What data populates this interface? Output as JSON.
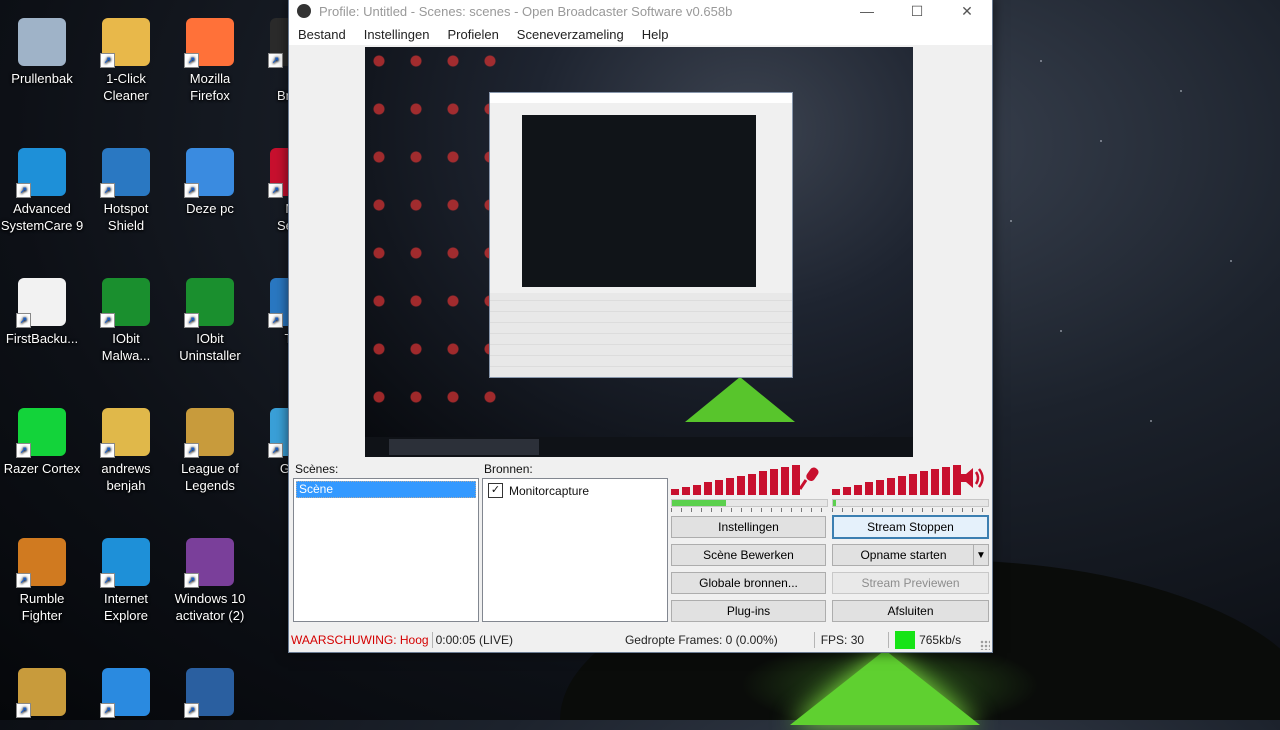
{
  "desktop": {
    "icons": [
      {
        "label": "Prullenbak",
        "icon": "recycle-bin-icon",
        "color": "#9fb3c8"
      },
      {
        "label": "1-Click\nCleaner",
        "icon": "broom-icon",
        "color": "#e8b84a"
      },
      {
        "label": "Mozilla\nFirefox",
        "icon": "firefox-icon",
        "color": "#ff7139"
      },
      {
        "label": "O\nBroac",
        "icon": "obs-icon",
        "color": "#2b2b2b"
      },
      {
        "label": "Advanced\nSystemCare 9",
        "icon": "advanced-systemcare-icon",
        "color": "#1e90d8"
      },
      {
        "label": "Hotspot\nShield",
        "icon": "hotspot-shield-icon",
        "color": "#2a78c2"
      },
      {
        "label": "Deze pc",
        "icon": "computer-icon",
        "color": "#3a8be0"
      },
      {
        "label": "Mc\nSecur",
        "icon": "mcafee-icon",
        "color": "#c8102e"
      },
      {
        "label": "FirstBacku...",
        "icon": "document-icon",
        "color": "#f2f2f2"
      },
      {
        "label": "IObit\nMalwa...",
        "icon": "iobit-malware-icon",
        "color": "#1a8f2e"
      },
      {
        "label": "IObit\nUninstaller",
        "icon": "iobit-uninstaller-icon",
        "color": "#1a8f2e"
      },
      {
        "label": "Tru",
        "icon": "app-icon",
        "color": "#2a78c2"
      },
      {
        "label": "Razer Cortex",
        "icon": "razer-cortex-icon",
        "color": "#13d33a"
      },
      {
        "label": "andrews\nbenjah",
        "icon": "user-folder-icon",
        "color": "#e0b84a"
      },
      {
        "label": "League of\nLegends",
        "icon": "league-of-legends-icon",
        "color": "#c89b3c"
      },
      {
        "label": "Gam",
        "icon": "app-icon",
        "color": "#3aa0d8"
      },
      {
        "label": "Rumble\nFighter",
        "icon": "rumble-fighter-icon",
        "color": "#d07a20"
      },
      {
        "label": "Internet\nExplore",
        "icon": "internet-explorer-icon",
        "color": "#1e90d8"
      },
      {
        "label": "Windows 10\nactivator (2)",
        "icon": "winrar-icon",
        "color": "#7a3f9a"
      },
      {
        "label": "",
        "icon": "league-of-legends-icon",
        "color": "#c89b3c"
      },
      {
        "label": "",
        "icon": "windows10-icon",
        "color": "#2a8ae0"
      },
      {
        "label": "",
        "icon": "battlenet-icon",
        "color": "#2a5fa0"
      }
    ]
  },
  "window": {
    "title": "Profile: Untitled - Scenes: scenes - Open Broadcaster Software v0.658b",
    "controls": {
      "minimize": "—",
      "maximize": "☐",
      "close": "✕"
    },
    "menu": [
      "Bestand",
      "Instellingen",
      "Profielen",
      "Sceneverzameling",
      "Help"
    ]
  },
  "scenes": {
    "label": "Scènes:",
    "items": [
      "Scène"
    ]
  },
  "sources": {
    "label": "Bronnen:",
    "items": [
      {
        "name": "Monitorcapture",
        "checked": true
      }
    ]
  },
  "audio": {
    "mic_icon": "microphone-icon",
    "speaker_icon": "speaker-icon",
    "mic_level": 0.35,
    "desktop_level": 0.02,
    "meter_color": "#c8102e",
    "slider_color": "#5bd04d"
  },
  "buttons": {
    "settings": "Instellingen",
    "stop_stream": "Stream Stoppen",
    "edit_scene": "Scène Bewerken",
    "start_recording": "Opname starten",
    "global_sources": "Globale bronnen...",
    "preview_stream": "Stream Previewen",
    "plugins": "Plug-ins",
    "exit": "Afsluiten"
  },
  "status": {
    "warning": "WAARSCHUWING: Hoog",
    "time": "0:00:05 (LIVE)",
    "dropped": "Gedropte Frames: 0 (0.00%)",
    "fps": "FPS: 30",
    "bitrate": "765kb/s",
    "bitrate_color": "#16e416",
    "warning_color": "#d40000"
  }
}
